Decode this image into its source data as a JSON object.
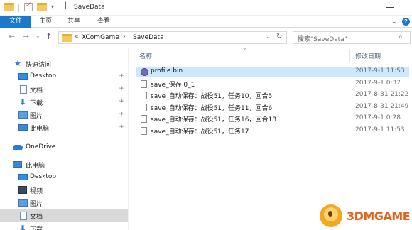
{
  "window": {
    "title": "SaveData",
    "accent_color": "#1979ca"
  },
  "ribbon": {
    "tabs": [
      "文件",
      "主页",
      "共享",
      "查看"
    ]
  },
  "address": {
    "overflow": "«",
    "crumbs": [
      "XComGame",
      "SaveData"
    ],
    "separator": "›"
  },
  "search": {
    "placeholder": "搜索\"SaveData\""
  },
  "navigation": {
    "quick_access": "快速访问",
    "quick_items": [
      "Desktop",
      "文档",
      "下载",
      "图片",
      "此电脑"
    ],
    "onedrive": "OneDrive",
    "this_pc": "此电脑",
    "pc_items": [
      "Desktop",
      "视频",
      "图片",
      "文档",
      "下载"
    ]
  },
  "columns": {
    "name": "名称",
    "modified": "修改日期"
  },
  "files": [
    {
      "name": "profile.bin",
      "date": "2017-9-1 11:53",
      "icon": "bin-file-icon"
    },
    {
      "name": "save_保存 0_1",
      "date": "2017-9-1 0:37",
      "icon": "file-icon"
    },
    {
      "name": "save_自动保存：战役51，任务10，回合5",
      "date": "2017-8-31 21:22",
      "icon": "file-icon"
    },
    {
      "name": "save_自动保存：战役51，任务11，回合6",
      "date": "2017-8-31 21:49",
      "icon": "file-icon"
    },
    {
      "name": "save_自动保存：战役51，任务16，回合18",
      "date": "2017-9-1 0:28",
      "icon": "file-icon"
    },
    {
      "name": "save_自动保存：战役51，任务17",
      "date": "2017-9-1 11:53",
      "icon": "file-icon"
    }
  ],
  "watermark": {
    "text": "3DMGAME"
  }
}
